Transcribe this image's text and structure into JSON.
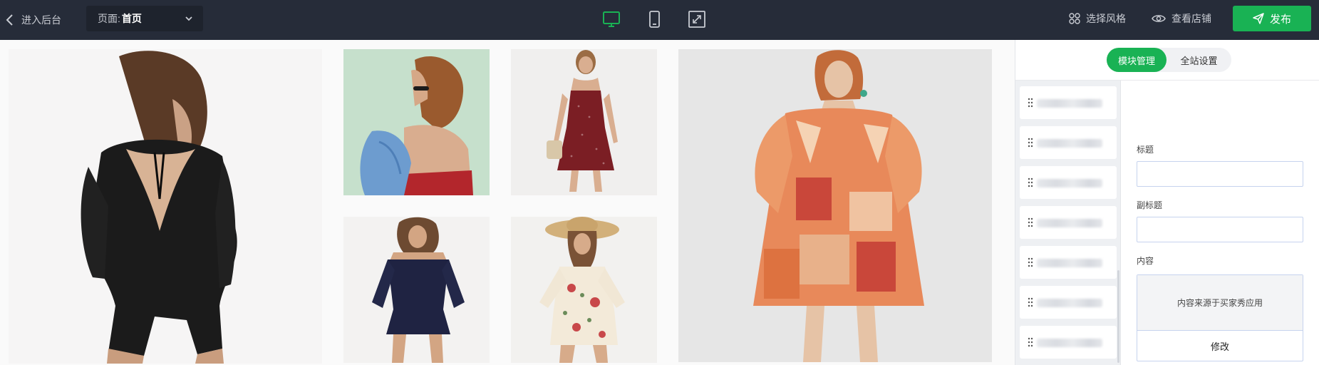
{
  "topbar": {
    "back_label": "进入后台",
    "page_prefix": "页面:",
    "page_value": "首页",
    "style_label": "选择风格",
    "view_label": "查看店铺",
    "publish_label": "发布",
    "active_device": "desktop"
  },
  "colors": {
    "topbar_bg": "#262c39",
    "accent_green": "#19b254",
    "panel_bg": "#ffffff",
    "module_list_bg": "#eef0f3"
  },
  "icons": {
    "back": "chevron-left-icon",
    "page_dropdown": "chevron-down-icon",
    "desktop": "desktop-icon",
    "mobile": "mobile-icon",
    "fullscreen": "fullscreen-icon",
    "style": "grid-icon",
    "view": "eye-icon",
    "publish": "send-icon",
    "drag": "drag-handle-icon"
  },
  "panel": {
    "tabs": [
      {
        "label": "模块管理",
        "active": true
      },
      {
        "label": "全站设置",
        "active": false
      }
    ],
    "module_count": 7,
    "form": {
      "title_label": "标题",
      "title_value": "",
      "subtitle_label": "副标题",
      "subtitle_value": "",
      "content_label": "内容",
      "content_note": "内容来源于买家秀应用",
      "edit_label": "修改"
    }
  },
  "canvas": {
    "photos": [
      "black-romper",
      "red-bandeau",
      "red-polka-dress",
      "navy-off-shoulder-romper",
      "floral-romper-straw-hat",
      "orange-patchwork-dress"
    ]
  }
}
